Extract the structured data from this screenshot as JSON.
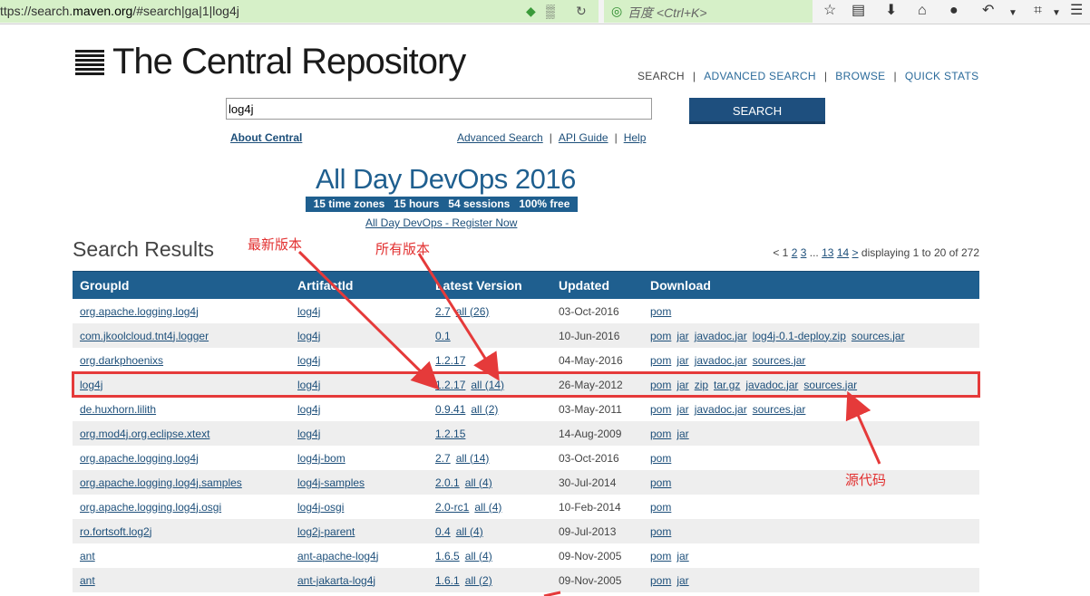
{
  "browser": {
    "url_prefix": "ttps://search.",
    "url_domain": "maven.org",
    "url_suffix": "/#search|ga|1|log4j",
    "search_placeholder": "百度 <Ctrl+K>"
  },
  "header": {
    "title": "The Central Repository",
    "nav": [
      "SEARCH",
      "ADVANCED SEARCH",
      "BROWSE",
      "QUICK STATS"
    ]
  },
  "search": {
    "query": "log4j",
    "button": "SEARCH",
    "about": "About Central",
    "links": [
      "Advanced Search",
      "API Guide",
      "Help"
    ]
  },
  "banner": {
    "title": "All Day DevOps 2016",
    "tagline": "15 time zones   15 hours   54 sessions   100% free",
    "link": "All Day DevOps - Register Now"
  },
  "results": {
    "heading": "Search Results",
    "pager": {
      "prefix": "< 1",
      "pages": [
        "2",
        "3"
      ],
      "ellipsis": "...",
      "last_pages": [
        "13",
        "14"
      ],
      "next": ">",
      "summary": "displaying 1 to 20 of 272"
    },
    "columns": [
      "GroupId",
      "ArtifactId",
      "Latest Version",
      "Updated",
      "Download"
    ],
    "rows": [
      {
        "group": "org.apache.logging.log4j",
        "artifact": "log4j",
        "version": "2.7",
        "all": "all (26)",
        "updated": "03-Oct-2016",
        "downloads": [
          "pom"
        ]
      },
      {
        "group": "com.jkoolcloud.tnt4j.logger",
        "artifact": "log4j",
        "version": "0.1",
        "all": "",
        "updated": "10-Jun-2016",
        "downloads": [
          "pom",
          "jar",
          "javadoc.jar",
          "log4j-0.1-deploy.zip",
          "sources.jar"
        ]
      },
      {
        "group": "org.darkphoenixs",
        "artifact": "log4j",
        "version": "1.2.17",
        "all": "",
        "updated": "04-May-2016",
        "downloads": [
          "pom",
          "jar",
          "javadoc.jar",
          "sources.jar"
        ]
      },
      {
        "group": "log4j",
        "artifact": "log4j",
        "version": "1.2.17",
        "all": "all (14)",
        "updated": "26-May-2012",
        "downloads": [
          "pom",
          "jar",
          "zip",
          "tar.gz",
          "javadoc.jar",
          "sources.jar"
        ]
      },
      {
        "group": "de.huxhorn.lilith",
        "artifact": "log4j",
        "version": "0.9.41",
        "all": "all (2)",
        "updated": "03-May-2011",
        "downloads": [
          "pom",
          "jar",
          "javadoc.jar",
          "sources.jar"
        ]
      },
      {
        "group": "org.mod4j.org.eclipse.xtext",
        "artifact": "log4j",
        "version": "1.2.15",
        "all": "",
        "updated": "14-Aug-2009",
        "downloads": [
          "pom",
          "jar"
        ]
      },
      {
        "group": "org.apache.logging.log4j",
        "artifact": "log4j-bom",
        "version": "2.7",
        "all": "all (14)",
        "updated": "03-Oct-2016",
        "downloads": [
          "pom"
        ]
      },
      {
        "group": "org.apache.logging.log4j.samples",
        "artifact": "log4j-samples",
        "version": "2.0.1",
        "all": "all (4)",
        "updated": "30-Jul-2014",
        "downloads": [
          "pom"
        ]
      },
      {
        "group": "org.apache.logging.log4j.osgi",
        "artifact": "log4j-osgi",
        "version": "2.0-rc1",
        "all": "all (4)",
        "updated": "10-Feb-2014",
        "downloads": [
          "pom"
        ]
      },
      {
        "group": "ro.fortsoft.log2j",
        "artifact": "log2j-parent",
        "version": "0.4",
        "all": "all (4)",
        "updated": "09-Jul-2013",
        "downloads": [
          "pom"
        ]
      },
      {
        "group": "ant",
        "artifact": "ant-apache-log4j",
        "version": "1.6.5",
        "all": "all (4)",
        "updated": "09-Nov-2005",
        "downloads": [
          "pom",
          "jar"
        ]
      },
      {
        "group": "ant",
        "artifact": "ant-jakarta-log4j",
        "version": "1.6.1",
        "all": "all (2)",
        "updated": "09-Nov-2005",
        "downloads": [
          "pom",
          "jar"
        ]
      }
    ]
  },
  "annotations": {
    "latest_version": "最新版本",
    "all_versions": "所有版本",
    "source_code": "源代码",
    "color": "#e23030"
  },
  "colors": {
    "accent": "#1f5f8f",
    "link": "#1d4f7a",
    "browser_bar": "#d6f0c8"
  }
}
